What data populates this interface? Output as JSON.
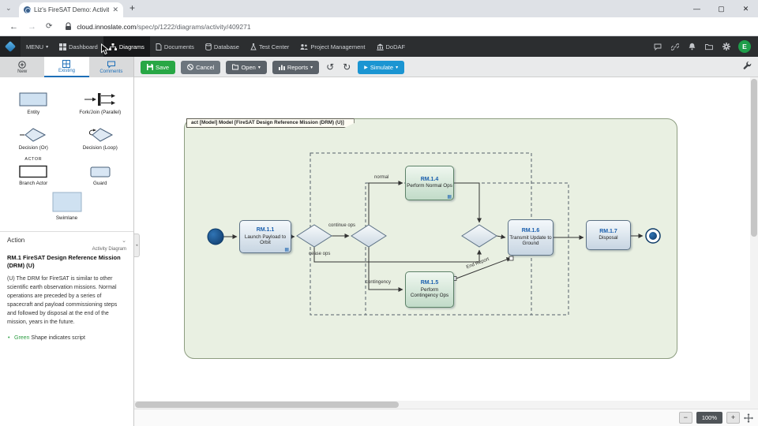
{
  "browser": {
    "tab_title": "Liz's FireSAT Demo: Activity Diag",
    "url_host": "cloud.innoslate.com",
    "url_path": "/spec/p/1222/diagrams/activity/409271",
    "window": {
      "minimize": "—",
      "maximize": "▢",
      "close": "✕"
    },
    "icons": {
      "tab_chevron": "⌄",
      "tab_close": "✕",
      "new_tab": "+",
      "back": "←",
      "forward": "→",
      "refresh": "⟳",
      "lock": "padlock-shape"
    }
  },
  "navbar": {
    "menu_label": "MENU",
    "caret": "▾",
    "items": [
      {
        "label": "Dashboard"
      },
      {
        "label": "Diagrams"
      },
      {
        "label": "Documents"
      },
      {
        "label": "Database"
      },
      {
        "label": "Test Center"
      },
      {
        "label": "Project Management"
      },
      {
        "label": "DoDAF"
      }
    ],
    "avatar_initial": "E"
  },
  "toolbar": {
    "tabs": [
      {
        "label": "New"
      },
      {
        "label": "Existing"
      },
      {
        "label": "Comments"
      }
    ],
    "save_label": "Save",
    "cancel_label": "Cancel",
    "open_label": "Open",
    "reports_label": "Reports",
    "simulate_label": "Simulate",
    "caret": "▾",
    "undo_icon": "↺",
    "redo_icon": "↻",
    "play_icon": "▶"
  },
  "palette": {
    "items": [
      {
        "label": "Entity"
      },
      {
        "label": "Fork/Join (Parallel)"
      },
      {
        "label": "Decision (Or)"
      },
      {
        "label": "Decision (Loop)"
      },
      {
        "label": "Branch Actor"
      },
      {
        "label": "Guard"
      },
      {
        "label": "Swimlane"
      }
    ],
    "actor_tag": "ACTOR",
    "section_label": "Action",
    "section_caret": "⌄"
  },
  "info": {
    "diagram_type_label": "Activity Diagram",
    "title": "RM.1 FireSAT Design Reference Mission (DRM) (U)",
    "description": "(U) The DRM for FireSAT is similar to other scientific earth observation missions. Normal operations are preceded by a series of spacecraft and payload commissioning steps and followed by disposal at the end of the mission, years in the future.",
    "bullet_green": "Green",
    "bullet_rest": " Shape indicates script"
  },
  "diagram": {
    "frame_label": "act [Model] Model [FireSAT Design Reference Mission (DRM) (U)]",
    "nodes": {
      "rm11": {
        "id": "RM.1.1",
        "name": "Launch Payload to Orbit"
      },
      "rm14": {
        "id": "RM.1.4",
        "name": "Perform Normal Ops"
      },
      "rm15": {
        "id": "RM.1.5",
        "name": "Perform Contingency Ops"
      },
      "rm16": {
        "id": "RM.1.6",
        "name": "Transmit Update to Ground"
      },
      "rm17": {
        "id": "RM.1.7",
        "name": "Disposal"
      }
    },
    "edge_labels": {
      "continue_ops": "continue ops",
      "cease_ops": "cease ops",
      "normal": "normal",
      "contingency": "contingency",
      "end_report": "End Report"
    },
    "script_icon_glyph": "▦"
  },
  "statusbar": {
    "zoom_out": "−",
    "zoom_level": "100%",
    "zoom_in": "+"
  },
  "colors": {
    "save_green": "#28a745",
    "simulate_blue": "#1b95d2",
    "avatar_green": "#1e9e4a",
    "navbar_bg": "#2c2e30",
    "frame_bg": "#e9f0e2",
    "action_node_blue": "#c7d5e2",
    "script_node_green": "#c1dbc8",
    "node_id_blue": "#1a5fae",
    "script_hint_green": "#2f9e44"
  }
}
